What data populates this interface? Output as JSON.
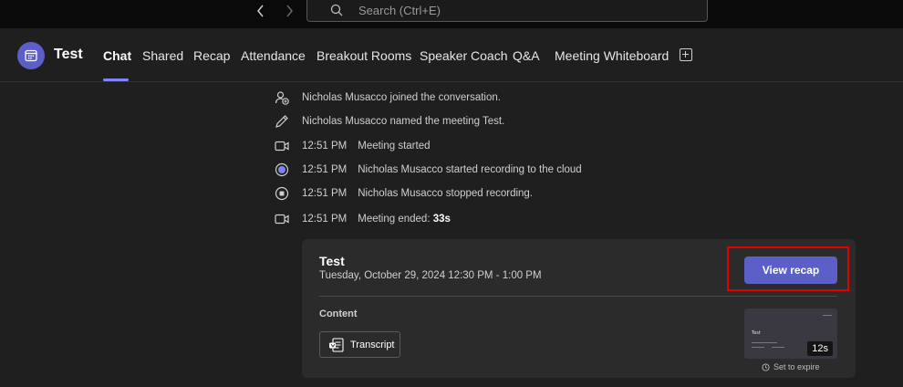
{
  "topbar": {
    "search_placeholder": "Search (Ctrl+E)"
  },
  "header": {
    "title": "Test",
    "tabs": [
      {
        "label": "Chat",
        "active": true
      },
      {
        "label": "Shared",
        "active": false
      },
      {
        "label": "Recap",
        "active": false
      },
      {
        "label": "Attendance",
        "active": false
      },
      {
        "label": "Breakout Rooms",
        "active": false
      },
      {
        "label": "Speaker Coach",
        "active": false
      },
      {
        "label": "Q&A",
        "active": false
      },
      {
        "label": "Meeting Whiteboard",
        "active": false
      }
    ]
  },
  "events": [
    {
      "icon": "person-add-icon",
      "time": "",
      "text": "Nicholas Musacco joined the conversation."
    },
    {
      "icon": "pencil-icon",
      "time": "",
      "text": "Nicholas Musacco named the meeting Test."
    },
    {
      "icon": "video-camera-icon",
      "time": "12:51 PM",
      "text": "Meeting started"
    },
    {
      "icon": "recording-icon",
      "time": "12:51 PM",
      "text": "Nicholas Musacco started recording to the cloud"
    },
    {
      "icon": "stop-recording-icon",
      "time": "12:51 PM",
      "text": "Nicholas Musacco stopped recording."
    },
    {
      "icon": "video-camera-icon",
      "time": "12:51 PM",
      "text": "Meeting ended: ",
      "bold": "33s"
    }
  ],
  "card": {
    "title": "Test",
    "date": "Tuesday, October 29, 2024 12:30 PM - 1:00 PM",
    "view_recap_label": "View recap",
    "content_label": "Content",
    "transcript_label": "Transcript",
    "thumb_title": "Test",
    "duration": "12s",
    "expire_label": "Set to expire"
  },
  "colors": {
    "accent": "#5b5fc7",
    "tab_underline": "#7f85f5",
    "highlight": "#e00000"
  }
}
